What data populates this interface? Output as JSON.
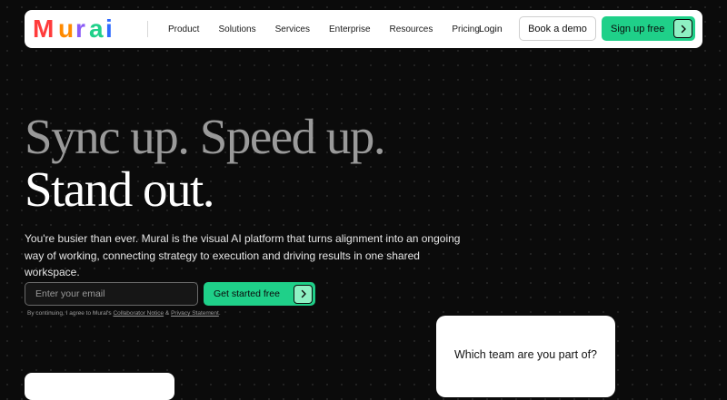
{
  "brand": {
    "name": "Mural",
    "letters": [
      "M",
      "u",
      "r",
      "a",
      "i"
    ],
    "letter_colors": [
      "#ff3b3b",
      "#ff8a00",
      "#8b5cf6",
      "#1fd089",
      "#2f6bff"
    ]
  },
  "nav": {
    "links": [
      "Product",
      "Solutions",
      "Services",
      "Enterprise",
      "Resources",
      "Pricing"
    ],
    "login": "Login",
    "book_demo": "Book a demo",
    "sign_up": "Sign up free"
  },
  "hero": {
    "line1": "Sync up. Speed up.",
    "line2": "Stand out.",
    "subtext": "You're busier than ever. Mural is the visual AI platform that turns alignment into an ongoing way of working, connecting strategy to execution and driving results in one shared workspace.",
    "email_placeholder": "Enter your email",
    "cta": "Get started free",
    "legal_prefix": "By continuing, I agree to Mural's",
    "legal_link1": "Collaborator Notice",
    "legal_amp": "&",
    "legal_link2": "Privacy Statement",
    "legal_end": "."
  },
  "card": {
    "question": "Which team are you part of?"
  },
  "colors": {
    "accent": "#1fd089",
    "background": "#0b0b0b",
    "headline_muted": "#9a9a9a"
  }
}
